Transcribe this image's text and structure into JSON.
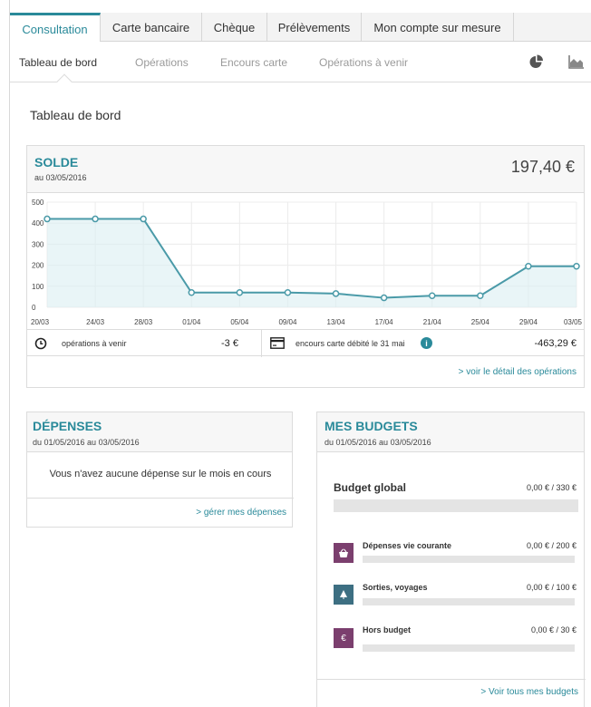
{
  "tabs": [
    {
      "label": "Consultation"
    },
    {
      "label": "Carte bancaire"
    },
    {
      "label": "Chèque"
    },
    {
      "label": "Prélèvements"
    },
    {
      "label": "Mon compte sur mesure"
    }
  ],
  "subnav": [
    {
      "label": "Tableau de bord"
    },
    {
      "label": "Opérations"
    },
    {
      "label": "Encours carte"
    },
    {
      "label": "Opérations à venir"
    }
  ],
  "subnav_icons": [
    "pie-chart-icon",
    "area-chart-icon"
  ],
  "page_title": "Tableau de bord",
  "solde": {
    "title": "SOLDE",
    "date": "au 03/05/2016",
    "amount": "197,40 €"
  },
  "chart_data": {
    "type": "area",
    "categories": [
      "20/03",
      "24/03",
      "28/03",
      "01/04",
      "05/04",
      "09/04",
      "13/04",
      "17/04",
      "21/04",
      "25/04",
      "29/04",
      "03/05"
    ],
    "values": [
      420,
      420,
      420,
      70,
      70,
      70,
      65,
      45,
      55,
      55,
      195,
      195
    ],
    "ylim": [
      0,
      500
    ],
    "yticks": [
      0,
      100,
      200,
      300,
      400,
      500
    ],
    "grid": true,
    "colors": {
      "line": "#4a9aa8",
      "fill": "#dbeef1"
    }
  },
  "info": {
    "upcoming_label": "opérations à venir",
    "upcoming_value": "-3 €",
    "card_label": "encours carte débité le 31 mai",
    "card_value": "-463,29 €",
    "detail_link": "> voir le détail des opérations"
  },
  "depenses": {
    "title": "DÉPENSES",
    "period": "du 01/05/2016 au 03/05/2016",
    "empty_text": "Vous n'avez aucune dépense sur le mois en cours",
    "manage_link": "> gérer mes dépenses"
  },
  "budgets": {
    "title": "MES BUDGETS",
    "period": "du 01/05/2016 au 03/05/2016",
    "global_label": "Budget global",
    "global_value": "0,00 € / 330 €",
    "items": [
      {
        "label": "Dépenses vie courante",
        "value": "0,00 € / 200 €",
        "icon": "basket-icon",
        "color": "#7b3f6e"
      },
      {
        "label": "Sorties, voyages",
        "value": "0,00 € / 100 €",
        "icon": "sailboat-icon",
        "color": "#3d6f82"
      },
      {
        "label": "Hors budget",
        "value": "0,00 € / 30 €",
        "icon": "euro-icon",
        "color": "#7b3f6e"
      }
    ],
    "all_link": "> Voir tous mes budgets"
  },
  "accent_color": "#2a8a9a"
}
